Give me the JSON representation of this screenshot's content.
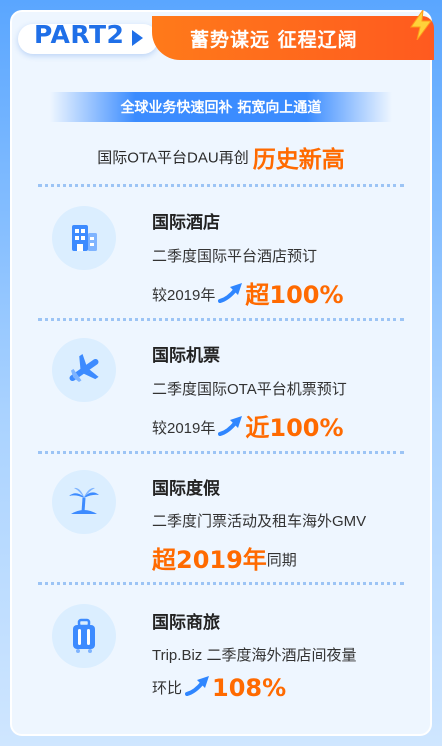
{
  "header": {
    "part_label": "PART2",
    "title": "蓄势谋远 征程辽阔"
  },
  "subtitle": "全球业务快速回补 拓宽向上通道",
  "headline": {
    "prefix": "国际OTA平台DAU再创",
    "emphasis": "历史新高"
  },
  "sections": [
    {
      "icon": "hotel-building-icon",
      "title": "国际酒店",
      "line1": "二季度国际平台酒店预订",
      "line2_prefix": "较2019年",
      "line2_emphasis": "超100%",
      "line2_suffix": ""
    },
    {
      "icon": "airplane-icon",
      "title": "国际机票",
      "line1": "二季度国际OTA平台机票预订",
      "line2_prefix": "较2019年",
      "line2_emphasis": "近100%",
      "line2_suffix": ""
    },
    {
      "icon": "palm-island-icon",
      "title": "国际度假",
      "line1": "二季度门票活动及租车海外GMV",
      "line2_prefix": "",
      "line2_emphasis": "超2019年",
      "line2_suffix": "同期"
    },
    {
      "icon": "suitcase-icon",
      "title": "国际商旅",
      "line1": "Trip.Biz 二季度海外酒店间夜量",
      "line2_prefix": "环比",
      "line2_emphasis": "108%",
      "line2_suffix": ""
    }
  ],
  "colors": {
    "accent_blue": "#1f6fe8",
    "accent_orange": "#ff6a00",
    "icon_blue": "#3d8bff"
  }
}
